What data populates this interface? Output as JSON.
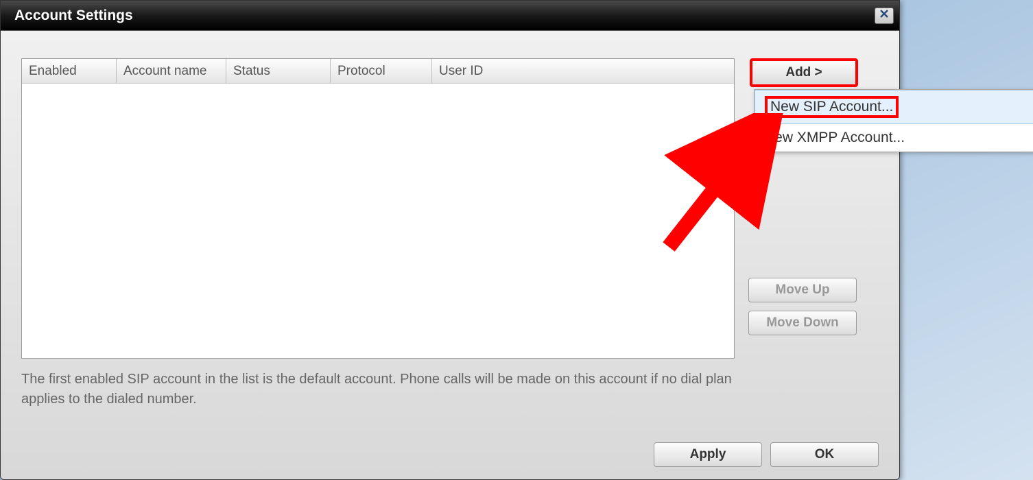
{
  "window": {
    "title": "Account Settings"
  },
  "table": {
    "columns": {
      "enabled": "Enabled",
      "account_name": "Account name",
      "status": "Status",
      "protocol": "Protocol",
      "user_id": "User ID"
    }
  },
  "buttons": {
    "add": "Add >",
    "move_up": "Move Up",
    "move_down": "Move Down",
    "apply": "Apply",
    "ok": "OK"
  },
  "menu": {
    "new_sip": "New SIP Account...",
    "new_xmpp": "New XMPP Account..."
  },
  "help_text": "The first enabled SIP account in the list is the default account. Phone calls will be made on this account if no dial plan applies to the dialed number."
}
